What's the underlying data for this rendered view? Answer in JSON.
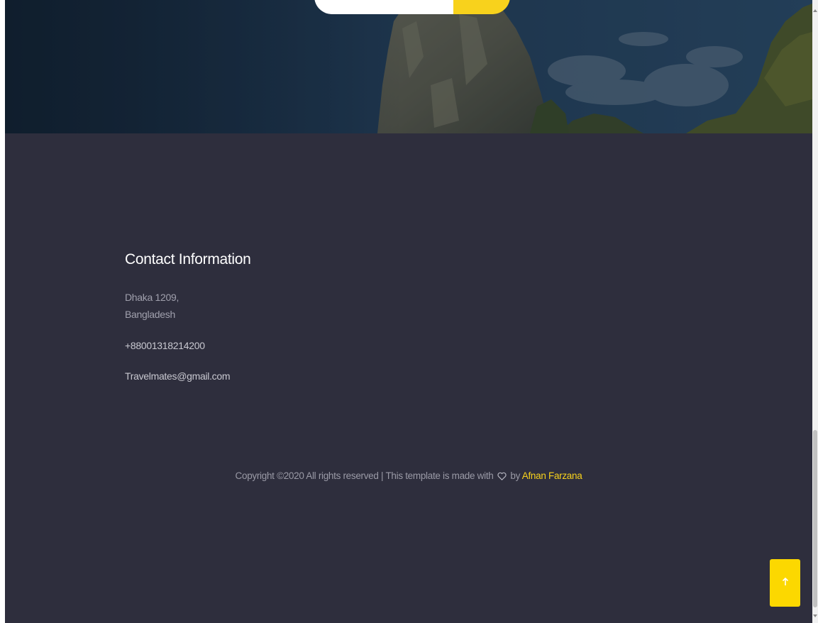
{
  "footer": {
    "contact": {
      "title": "Contact Information",
      "address_line1": "Dhaka 1209,",
      "address_line2": "Bangladesh",
      "phone": "+88001318214200",
      "email": "Travelmates@gmail.com"
    },
    "copyright": {
      "prefix": "Copyright ©2020 All rights reserved | This template is made with",
      "by": "by",
      "author": "Afnan Farzana"
    }
  },
  "icons": {
    "heart": "heart-icon",
    "back_to_top": "arrow-up-icon"
  },
  "colors": {
    "accent": "#f8d21c",
    "footer_bg": "#2e2e3d",
    "hero_sky": "#172d43"
  }
}
